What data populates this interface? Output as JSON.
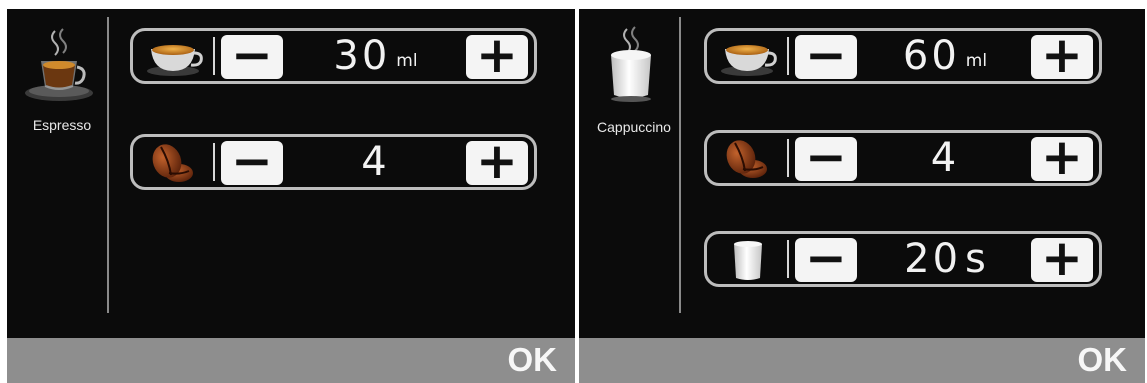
{
  "screens": [
    {
      "drink": {
        "label": "Espresso",
        "icon": "espresso-cup-icon"
      },
      "rows": [
        {
          "icon": "coffee-cup-icon",
          "value": "30",
          "unit": "ml"
        },
        {
          "icon": "coffee-bean-icon",
          "value": "4",
          "unit": ""
        }
      ],
      "ok_label": "OK"
    },
    {
      "drink": {
        "label": "Cappuccino",
        "icon": "cappuccino-glass-icon"
      },
      "rows": [
        {
          "icon": "coffee-cup-icon",
          "value": "60",
          "unit": "ml"
        },
        {
          "icon": "coffee-bean-icon",
          "value": "4",
          "unit": ""
        },
        {
          "icon": "milk-glass-icon",
          "value": "20",
          "unit": "s"
        }
      ],
      "ok_label": "OK"
    }
  ],
  "buttons": {
    "minus": "−",
    "plus": "+"
  },
  "colors": {
    "background": "#0b0b0b",
    "bar": "#8e8e8e",
    "button": "#f4f4f4",
    "border": "#bdbdbd"
  }
}
